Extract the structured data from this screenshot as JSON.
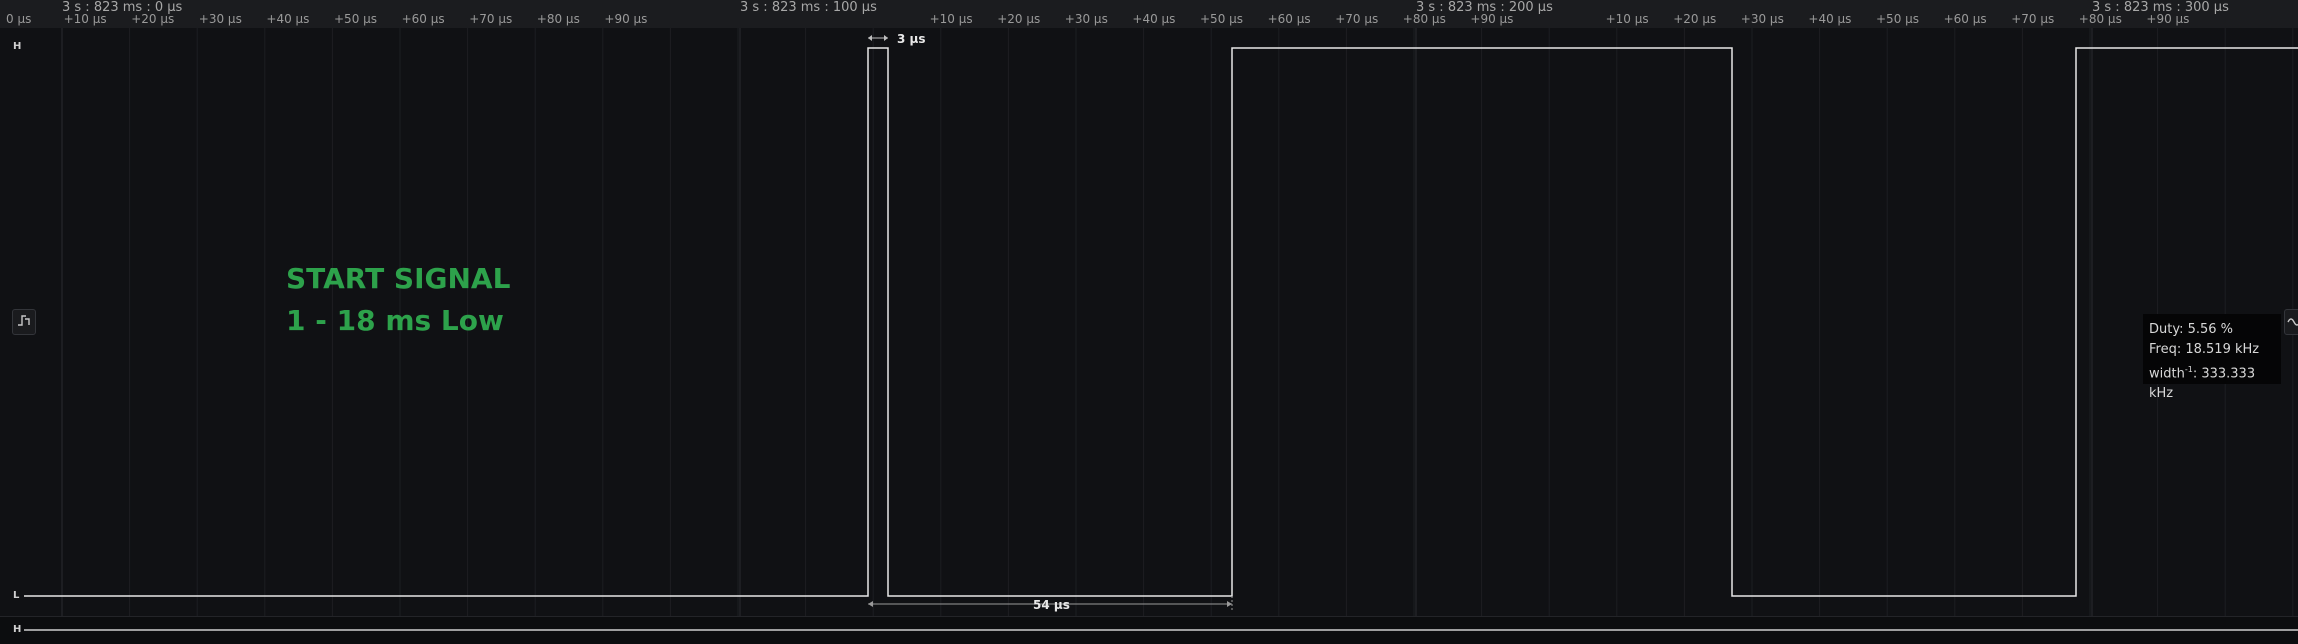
{
  "ruler": {
    "majors": [
      "3 s : 823 ms : 0 µs",
      "3 s : 823 ms : 100 µs",
      "3 s : 823 ms : 200 µs",
      "3 s : 823 ms : 300 µs"
    ],
    "start_label": "0 µs",
    "ticks": [
      "+10 µs",
      "+20 µs",
      "+30 µs",
      "+40 µs",
      "+50 µs",
      "+60 µs",
      "+70 µs",
      "+80 µs",
      "+90 µs"
    ]
  },
  "channel": {
    "high_label": "H",
    "low_label": "L",
    "next_high_label": "H"
  },
  "measurements": {
    "pulse_width": "3 µs",
    "low_span": "54 µs"
  },
  "annotation": {
    "line1": "START SIGNAL",
    "line2": "1 - 18 ms Low"
  },
  "tooltip": {
    "duty": "Duty: 5.56 %",
    "freq": "Freq: 18.519 kHz",
    "width_prefix": "width",
    "width_sup": "-1",
    "width_value": ": 333.333 kHz"
  },
  "icons": {
    "left_handle": "trigger-edge-icon",
    "right_handle": "measure-wave-icon"
  },
  "colors": {
    "background": "#101114",
    "trace": "#e8e8e8",
    "annotation": "#2da24b",
    "grid": "#1f2024"
  }
}
